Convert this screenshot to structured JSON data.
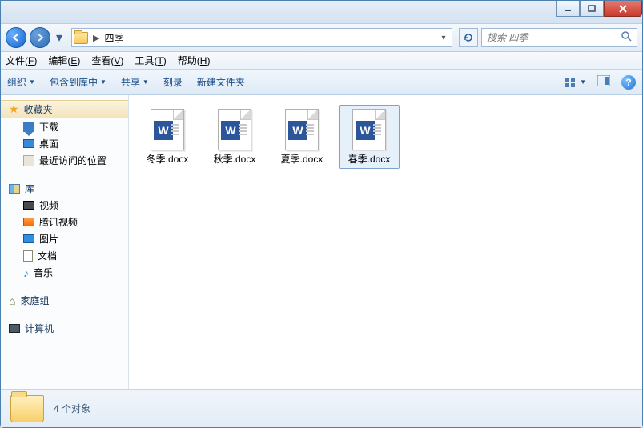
{
  "window_controls": {
    "minimize": "min",
    "maximize": "max",
    "close": "close"
  },
  "address": {
    "folder_name": "四季",
    "separator": "▶"
  },
  "search": {
    "placeholder": "搜索 四季"
  },
  "menubar": [
    {
      "label": "文件",
      "accel": "F"
    },
    {
      "label": "编辑",
      "accel": "E"
    },
    {
      "label": "查看",
      "accel": "V"
    },
    {
      "label": "工具",
      "accel": "T"
    },
    {
      "label": "帮助",
      "accel": "H"
    }
  ],
  "toolbar": {
    "organize": "组织",
    "include": "包含到库中",
    "share": "共享",
    "burn": "刻录",
    "newfolder": "新建文件夹"
  },
  "sidebar": {
    "favorites": {
      "label": "收藏夹",
      "items": [
        "下载",
        "桌面",
        "最近访问的位置"
      ]
    },
    "libraries": {
      "label": "库",
      "items": [
        "视频",
        "腾讯视频",
        "图片",
        "文档",
        "音乐"
      ]
    },
    "homegroup": {
      "label": "家庭组"
    },
    "computer": {
      "label": "计算机"
    }
  },
  "files": [
    {
      "name": "冬季.docx",
      "selected": false
    },
    {
      "name": "秋季.docx",
      "selected": false
    },
    {
      "name": "夏季.docx",
      "selected": false
    },
    {
      "name": "春季.docx",
      "selected": true
    }
  ],
  "status": {
    "text": "4 个对象"
  }
}
